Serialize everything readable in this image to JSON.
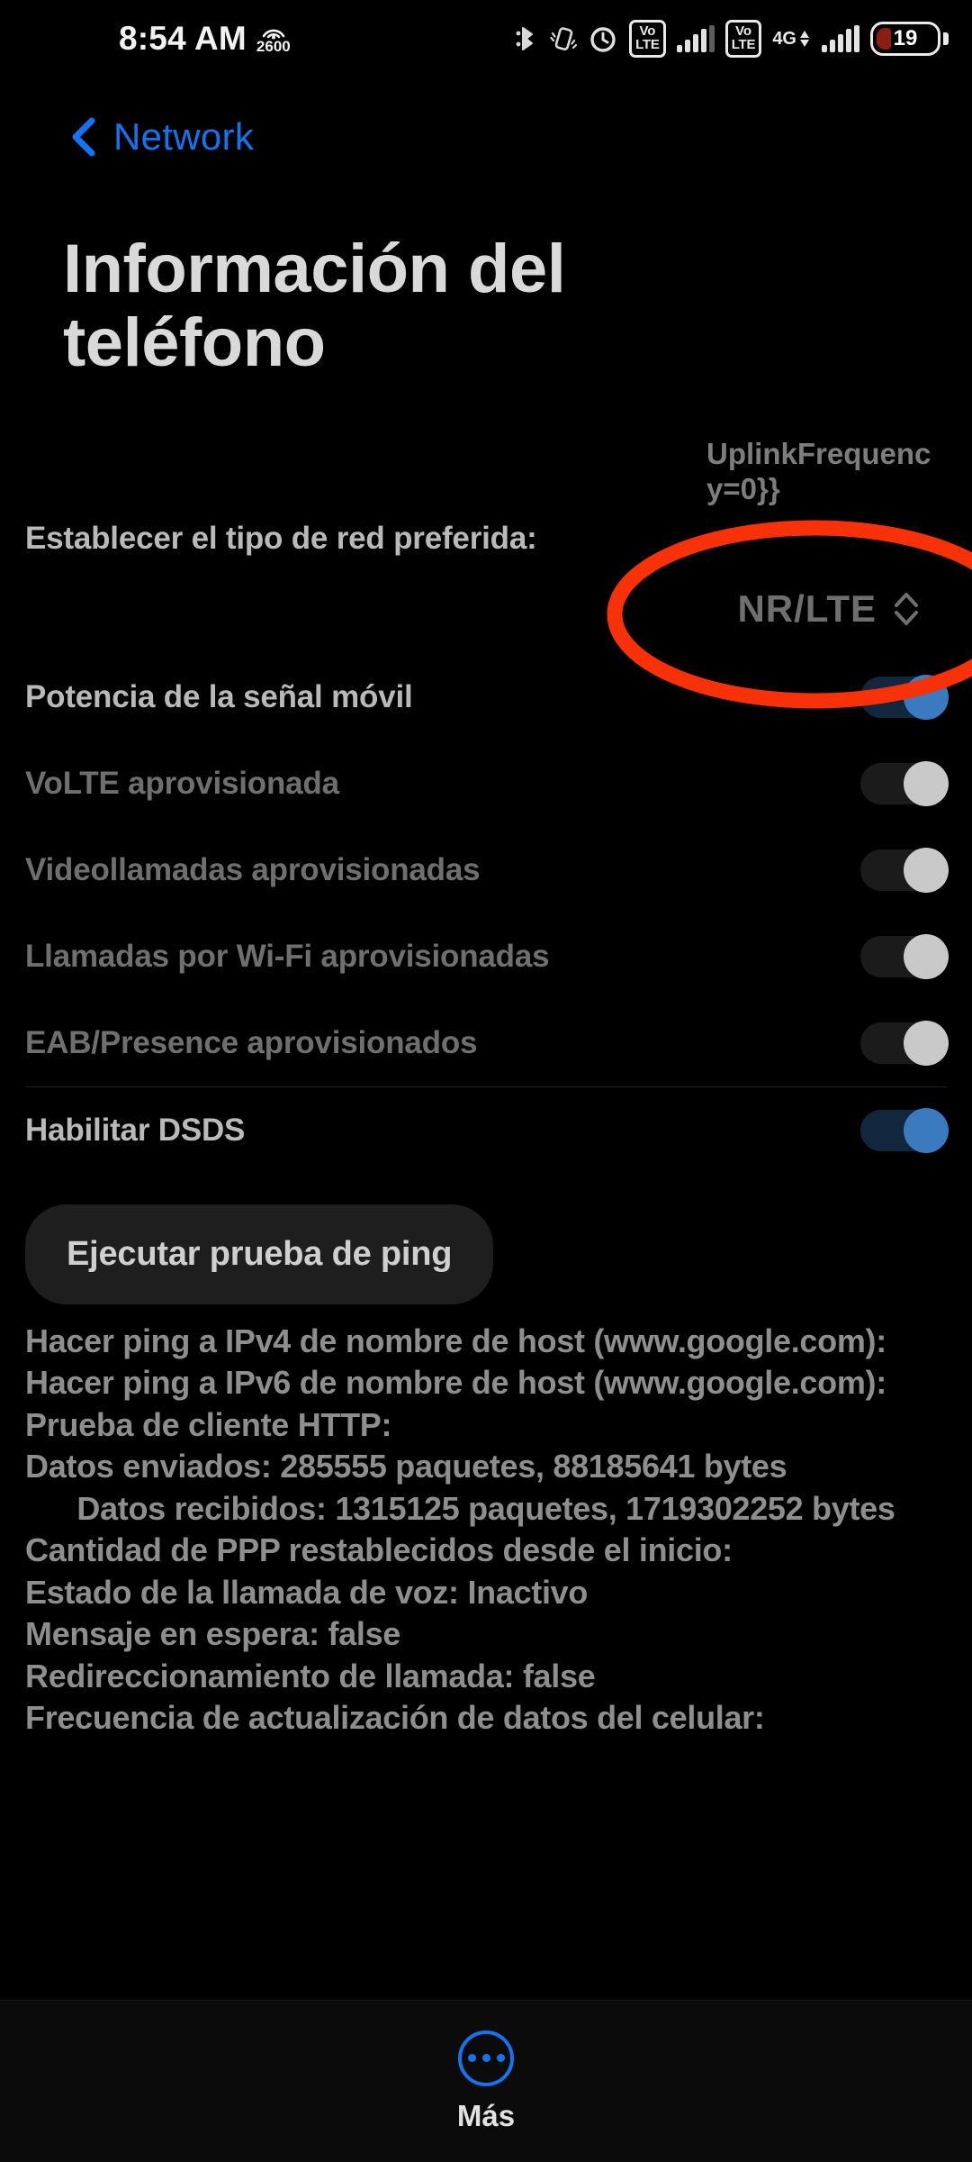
{
  "status_bar": {
    "time": "8:54 AM",
    "hotspot_label": "2600",
    "icons": [
      "bluetooth-icon",
      "vibrate-icon",
      "alarm-icon",
      "volte-icon",
      "signal-bars-icon",
      "volte-icon",
      "4g-icon",
      "signal-bars-icon",
      "battery-icon"
    ],
    "volte_line1": "Vo",
    "volte_line2": "LTE",
    "network_type": "4G",
    "battery_level": "19"
  },
  "header": {
    "back_label": "Network",
    "title": "Información del teléfono",
    "accent_color": "#1473f0"
  },
  "overflow_text": "UplinkFrequency=0}}",
  "settings": {
    "preferred_network": {
      "label": "Establecer el tipo de red preferida:",
      "value": "NR/LTE"
    },
    "toggles": [
      {
        "label": "Potencia de la señal móvil",
        "state": "on",
        "dim": false
      },
      {
        "label": "VoLTE aprovisionada",
        "state": "off",
        "dim": true
      },
      {
        "label": "Videollamadas aprovisionadas",
        "state": "off",
        "dim": true
      },
      {
        "label": "Llamadas por Wi-Fi aprovisionadas",
        "state": "off",
        "dim": true
      },
      {
        "label": "EAB/Presence aprovisionados",
        "state": "off",
        "dim": true
      },
      {
        "label": "Habilitar DSDS",
        "state": "on",
        "dim": false
      }
    ]
  },
  "ping": {
    "button_label": "Ejecutar prueba de ping"
  },
  "info_lines": [
    {
      "text": "Hacer ping a IPv4 de nombre de host (www.google.com):",
      "align": "left"
    },
    {
      "text": "Hacer ping a IPv6 de nombre de host (www.google.com):",
      "align": "left"
    },
    {
      "text": "Prueba de cliente HTTP:",
      "align": "left"
    },
    {
      "text": "Datos enviados: 285555 paquetes, 88185641 bytes",
      "align": "left"
    },
    {
      "text": "Datos recibidos: 1315125 paquetes, 1719302252 bytes",
      "align": "center"
    },
    {
      "text": "Cantidad de PPP restablecidos desde el inicio:",
      "align": "left"
    },
    {
      "text": "Estado de la llamada de voz: Inactivo",
      "align": "left"
    },
    {
      "text": "Mensaje en espera: false",
      "align": "left"
    },
    {
      "text": "Redireccionamiento de llamada: false",
      "align": "left"
    },
    {
      "text": "Frecuencia de actualización de datos del celular:",
      "align": "left"
    }
  ],
  "annotation": {
    "shape": "ellipse",
    "color": "#f83108"
  },
  "bottom_nav": {
    "label": "Más",
    "icon": "more-dots-icon",
    "accent_color": "#1473f0"
  }
}
